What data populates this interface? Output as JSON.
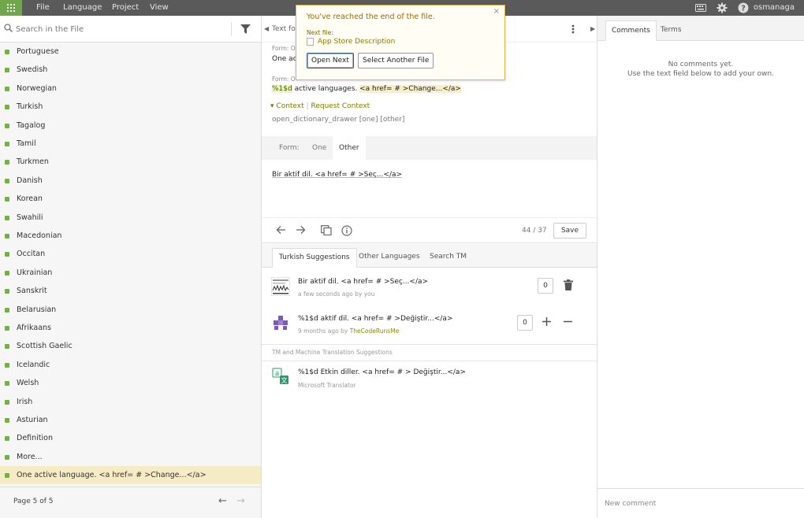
{
  "topbar": {
    "menu": [
      "File",
      "Language",
      "Project",
      "View"
    ],
    "username": "osmanaga",
    "icons": [
      "apps-grid-icon",
      "keyboard-icon",
      "gear-icon",
      "help-icon"
    ]
  },
  "left": {
    "search_placeholder": "Search in the File",
    "languages": [
      "Portuguese",
      "Swedish",
      "Norwegian",
      "Turkish",
      "Tagalog",
      "Tamil",
      "Turkmen",
      "Danish",
      "Korean",
      "Swahili",
      "Macedonian",
      "Occitan",
      "Ukrainian",
      "Sanskrit",
      "Belarusian",
      "Afrikaans",
      "Scottish Gaelic",
      "Icelandic",
      "Welsh",
      "Irish",
      "Asturian",
      "Definition",
      "More..."
    ],
    "active_item": "One active language. <a href= # >Change...</a>",
    "page_label": "Page 5 of 5",
    "status_color": "#72b340",
    "active_bg": "#f5ebc4"
  },
  "center": {
    "text_for": "Text fo",
    "form_one_label": "Form: O",
    "form_one_text": "One acti",
    "form_other_label": "Form: O",
    "source_placeholder": "%1$d",
    "source_rest": " active languages. ",
    "source_tag": "<a href= # >Change...</a>",
    "context_label": "Context",
    "request_context": "Request Context",
    "context_key": "open_dictionary_drawer [one] [other]",
    "form_tabs": {
      "label": "Form:",
      "one": "One",
      "other": "Other"
    },
    "translation": "Bir aktif dil. <a href= # >Seç...</a>",
    "char_count": "44 / 37",
    "save_label": "Save",
    "suggestion_tabs": [
      "Turkish Suggestions",
      "Other Languages",
      "Search TM"
    ],
    "suggestions": [
      {
        "text": "Bir aktif dil. <a href= # >Seç...</a>",
        "meta": "a few seconds ago by you",
        "author": "",
        "votes": "0"
      },
      {
        "text": "%1$d aktif dil. <a href= # >Değiştir...</a>",
        "meta": "9 months ago by ",
        "author": "TheCodeRunsMe",
        "votes": "0"
      }
    ],
    "tm_header": "TM and Machine Translation Suggestions",
    "mt": {
      "text": "%1$d Etkin diller. <a href= # > Değiştir...</a>",
      "source": "Microsoft Translator"
    }
  },
  "right": {
    "tabs": [
      "Comments",
      "Terms"
    ],
    "no_comments": "No comments yet.",
    "hint": "Use the text field below to add your own.",
    "new_comment_placeholder": "New comment"
  },
  "popup": {
    "title": "You've reached the end of the file.",
    "next_label": "Next file:",
    "next_file": "App Store Description",
    "open_next": "Open Next",
    "select_another": "Select Another File",
    "close": "×",
    "accent": "#e0b24a"
  }
}
